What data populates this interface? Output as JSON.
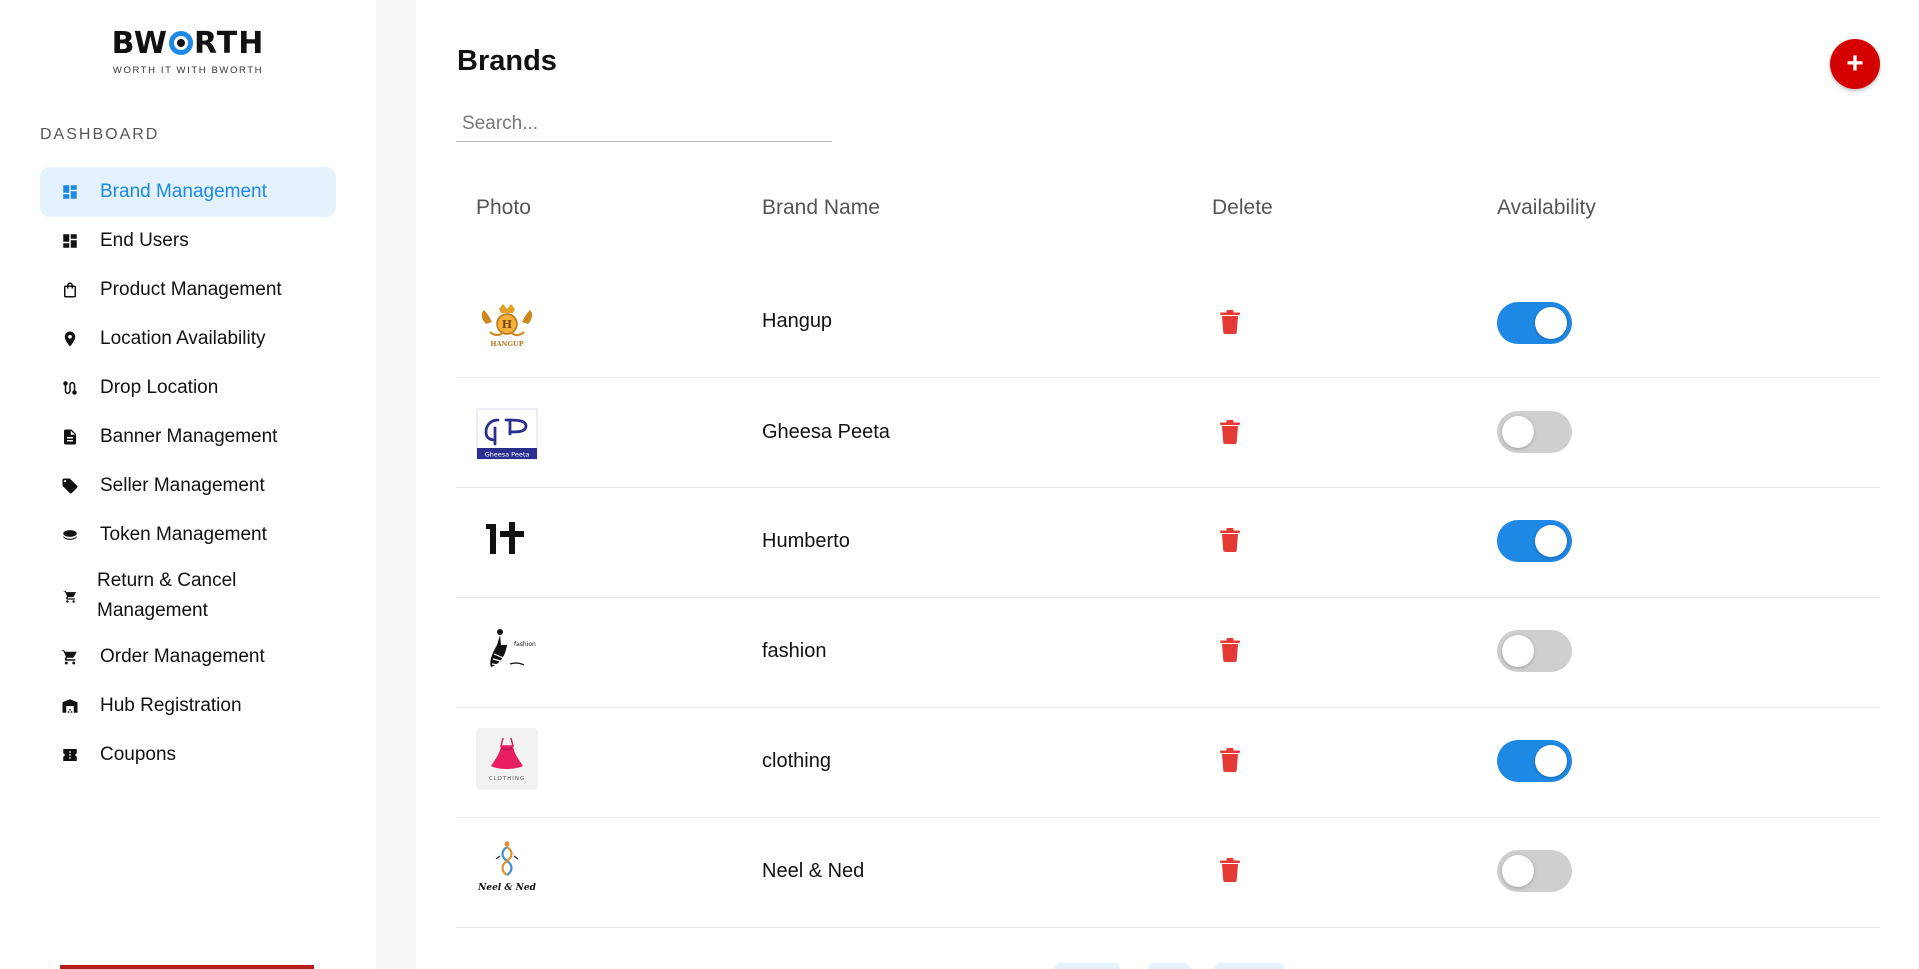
{
  "app": {
    "logo_text": "BWORTH",
    "logo_tagline": "WORTH IT WITH BWORTH"
  },
  "sidebar": {
    "section_label": "DASHBOARD",
    "items": [
      {
        "label": "Brand Management",
        "icon": "dashboard-icon",
        "active": true
      },
      {
        "label": "End Users",
        "icon": "dashboard-icon",
        "active": false
      },
      {
        "label": "Product Management",
        "icon": "shopping-bag-icon",
        "active": false
      },
      {
        "label": "Location Availability",
        "icon": "location-pin-icon",
        "active": false
      },
      {
        "label": "Drop Location",
        "icon": "route-icon",
        "active": false
      },
      {
        "label": "Banner Management",
        "icon": "document-icon",
        "active": false
      },
      {
        "label": "Seller Management",
        "icon": "tag-icon",
        "active": false
      },
      {
        "label": "Token Management",
        "icon": "token-icon",
        "active": false
      },
      {
        "label": "Return & Cancel",
        "label_line2": "Management",
        "icon": "cart-return-icon",
        "active": false
      },
      {
        "label": "Order Management",
        "icon": "cart-icon",
        "active": false
      },
      {
        "label": "Hub Registration",
        "icon": "warehouse-icon",
        "active": false
      },
      {
        "label": "Coupons",
        "icon": "coupon-icon",
        "active": false
      }
    ]
  },
  "main": {
    "title": "Brands",
    "search_placeholder": "Search...",
    "columns": [
      "Photo",
      "Brand Name",
      "Delete",
      "Availability"
    ],
    "rows": [
      {
        "name": "Hangup",
        "available": true,
        "logo": "hangup-logo"
      },
      {
        "name": "Gheesa Peeta",
        "available": false,
        "logo": "gheesa-peeta-logo"
      },
      {
        "name": "Humberto",
        "available": true,
        "logo": "humberto-logo"
      },
      {
        "name": "fashion",
        "available": false,
        "logo": "fashion-logo"
      },
      {
        "name": "clothing",
        "available": true,
        "logo": "clothing-logo"
      },
      {
        "name": "Neel & Ned",
        "available": false,
        "logo": "neel-ned-logo"
      }
    ]
  },
  "colors": {
    "accent": "#1e88e5",
    "active_bg": "#e3f2fd",
    "add_button": "#d50000",
    "delete_icon": "#e53935",
    "toggle_off": "#cfcfcf"
  }
}
